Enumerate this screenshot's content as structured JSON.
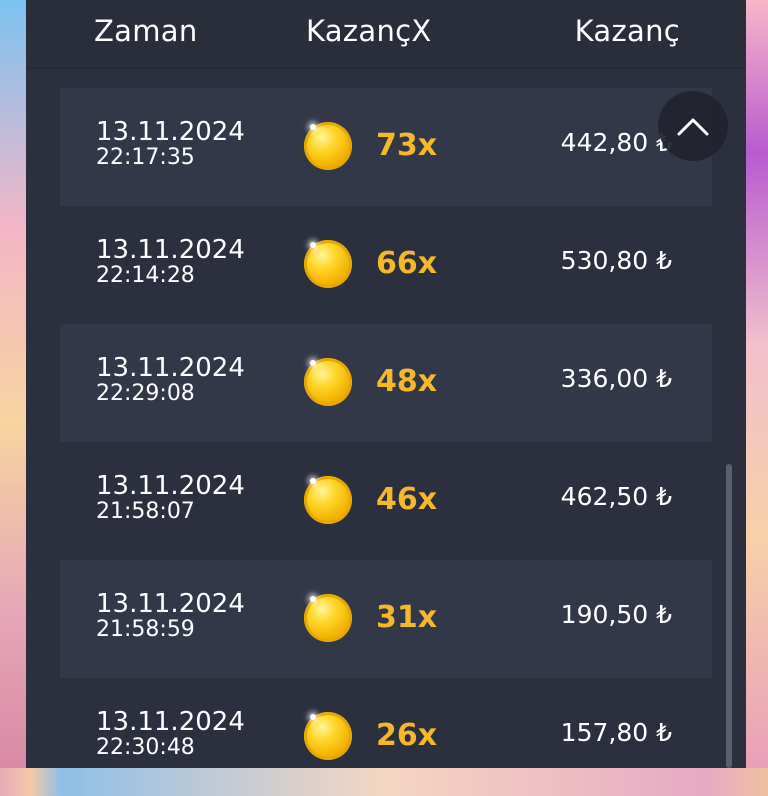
{
  "header": {
    "time_label": "Zaman",
    "multiplier_label": "KazançX",
    "win_label": "Kazanç"
  },
  "rows": [
    {
      "date": "13.11.2024",
      "time": "22:17:35",
      "multiplier": "73x",
      "win": "442,80 ₺"
    },
    {
      "date": "13.11.2024",
      "time": "22:14:28",
      "multiplier": "66x",
      "win": "530,80 ₺"
    },
    {
      "date": "13.11.2024",
      "time": "22:29:08",
      "multiplier": "48x",
      "win": "336,00 ₺"
    },
    {
      "date": "13.11.2024",
      "time": "21:58:07",
      "multiplier": "46x",
      "win": "462,50 ₺"
    },
    {
      "date": "13.11.2024",
      "time": "21:58:59",
      "multiplier": "31x",
      "win": "190,50 ₺"
    },
    {
      "date": "13.11.2024",
      "time": "22:30:48",
      "multiplier": "26x",
      "win": "157,80 ₺"
    }
  ],
  "icons": {
    "coin": "coin-icon",
    "scroll_up": "chevron-up-icon"
  },
  "colors": {
    "panel_bg": "#2b2f3e",
    "row_alt_bg": "#333849",
    "multiplier_text": "#f6b82b"
  }
}
